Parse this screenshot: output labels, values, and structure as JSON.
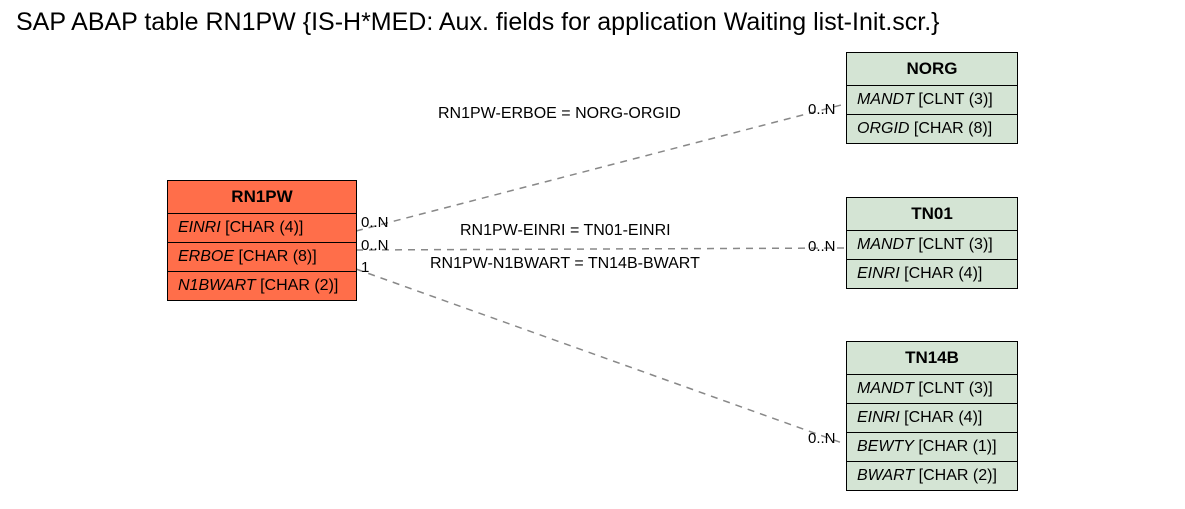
{
  "title": "SAP ABAP table RN1PW {IS-H*MED: Aux. fields for application Waiting list-Init.scr.}",
  "entities": {
    "rn1pw": {
      "name": "RN1PW",
      "fields": [
        {
          "name": "EINRI",
          "type": "[CHAR (4)]"
        },
        {
          "name": "ERBOE",
          "type": "[CHAR (8)]"
        },
        {
          "name": "N1BWART",
          "type": "[CHAR (2)]"
        }
      ]
    },
    "norg": {
      "name": "NORG",
      "fields": [
        {
          "name": "MANDT",
          "type": "[CLNT (3)]"
        },
        {
          "name": "ORGID",
          "type": "[CHAR (8)]"
        }
      ]
    },
    "tn01": {
      "name": "TN01",
      "fields": [
        {
          "name": "MANDT",
          "type": "[CLNT (3)]"
        },
        {
          "name": "EINRI",
          "type": "[CHAR (4)]"
        }
      ]
    },
    "tn14b": {
      "name": "TN14B",
      "fields": [
        {
          "name": "MANDT",
          "type": "[CLNT (3)]"
        },
        {
          "name": "EINRI",
          "type": "[CHAR (4)]"
        },
        {
          "name": "BEWTY",
          "type": "[CHAR (1)]"
        },
        {
          "name": "BWART",
          "type": "[CHAR (2)]"
        }
      ]
    }
  },
  "relations": {
    "r1": {
      "label": "RN1PW-ERBOE = NORG-ORGID",
      "left_card": "0..N",
      "right_card": "0..N"
    },
    "r2": {
      "label": "RN1PW-EINRI = TN01-EINRI",
      "left_card": "0..N",
      "right_card": "0..N"
    },
    "r3": {
      "label": "RN1PW-N1BWART = TN14B-BWART",
      "left_card": "1",
      "right_card": "0..N"
    }
  }
}
